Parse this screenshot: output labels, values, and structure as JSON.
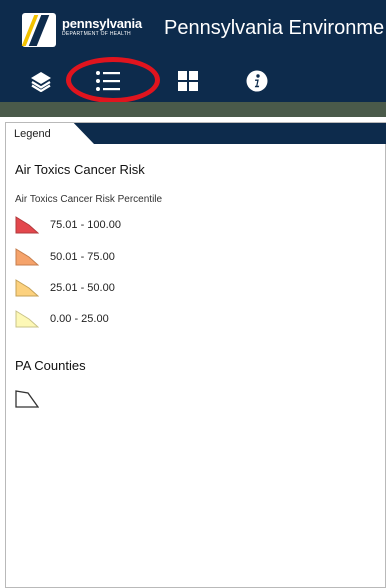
{
  "header": {
    "logo_main": "pennsylvania",
    "logo_sub": "DEPARTMENT OF HEALTH",
    "app_title": "Pennsylvania Environme"
  },
  "toolbar": {
    "icons": [
      "layers-icon",
      "legend-icon",
      "basemap-gallery-icon",
      "info-icon"
    ],
    "highlight_color": "#e0141e"
  },
  "legend_panel": {
    "tab_label": "Legend",
    "layers": [
      {
        "title": "Air Toxics Cancer Risk",
        "field": "Air Toxics Cancer Risk Percentile",
        "classes": [
          {
            "label": "75.01 - 100.00",
            "color": "#e3474c"
          },
          {
            "label": "50.01 - 75.00",
            "color": "#f5a36b"
          },
          {
            "label": "25.01 - 50.00",
            "color": "#fcd17e"
          },
          {
            "label": "0.00 - 25.00",
            "color": "#fdf8b6"
          }
        ]
      },
      {
        "title": "PA Counties",
        "symbol": "polygon-outline"
      }
    ]
  },
  "colors": {
    "header_bg": "#0d2b4c",
    "strip_bg": "#4a5a4a"
  }
}
